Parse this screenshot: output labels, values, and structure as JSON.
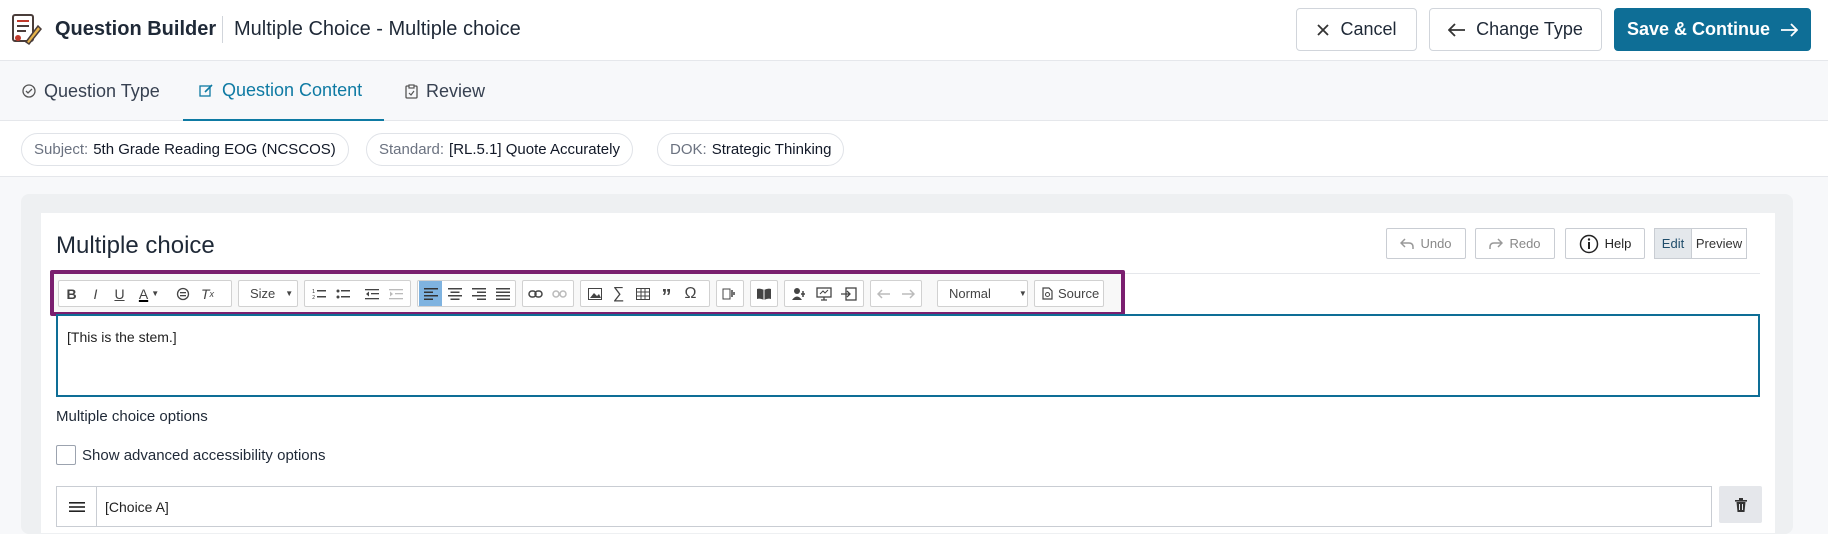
{
  "header": {
    "app_title": "Question Builder",
    "doc_title": "Multiple Choice - Multiple choice",
    "cancel_label": "Cancel",
    "change_type_label": "Change Type",
    "save_label": "Save & Continue",
    "accent_color": "#0e6e96"
  },
  "tabs": [
    {
      "label": "Question Type",
      "icon": "check-circle-icon",
      "active": false
    },
    {
      "label": "Question Content",
      "icon": "edit-icon",
      "active": true
    },
    {
      "label": "Review",
      "icon": "clipboard-icon",
      "active": false
    }
  ],
  "chips": [
    {
      "key": "Subject:",
      "value": "5th Grade Reading EOG (NCSCOS)"
    },
    {
      "key": "Standard:",
      "value": "[RL.5.1] Quote Accurately"
    },
    {
      "key": "DOK:",
      "value": "Strategic Thinking"
    }
  ],
  "editor_panel": {
    "title": "Multiple choice",
    "undo_label": "Undo",
    "redo_label": "Redo",
    "help_label": "Help",
    "edit_label": "Edit",
    "preview_label": "Preview",
    "toolbar": {
      "size_label": "Size",
      "format_label": "Normal",
      "source_label": "Source",
      "highlight_color": "#7a1f6f"
    },
    "stem_text": "[This is the stem.]",
    "options_label": "Multiple choice options",
    "accessibility_label": "Show advanced accessibility options",
    "accessibility_checked": false,
    "choices": [
      {
        "text": "[Choice A]"
      }
    ]
  }
}
